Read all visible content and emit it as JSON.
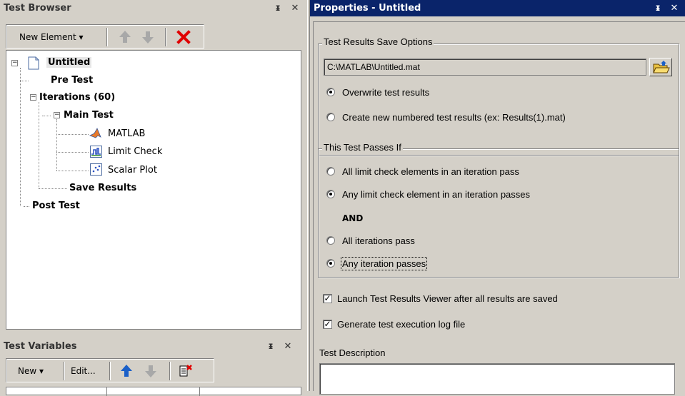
{
  "test_browser": {
    "title": "Test Browser",
    "pin_label": "ᵻ",
    "close_label": "✕",
    "toolbar": {
      "new_element_label": "New Element ▾"
    },
    "tree": {
      "root": "Untitled",
      "pre_test": "Pre Test",
      "iterations": "Iterations  (60)",
      "main_test": "Main Test",
      "matlab": "MATLAB",
      "limit_check": "Limit Check",
      "scalar_plot": "Scalar Plot",
      "save_results": "Save Results",
      "post_test": "Post Test"
    }
  },
  "test_variables": {
    "title": "Test Variables",
    "pin_label": "ᵻ",
    "close_label": "✕",
    "toolbar": {
      "new_label": "New ▾",
      "edit_label": "Edit..."
    }
  },
  "properties": {
    "title": "Properties - Untitled",
    "pin_label": "ᵻ",
    "close_label": "✕",
    "save_options": {
      "group_title": "Test Results Save Options",
      "file_path": "C:\\MATLAB\\Untitled.mat",
      "overwrite_label": "Overwrite test results",
      "create_new_label": "Create new numbered test results (ex: Results(1).mat)",
      "selected": "overwrite"
    },
    "pass_conditions": {
      "group_title": "This Test Passes If",
      "all_limit_label": "All limit check elements in an iteration pass",
      "any_limit_label": "Any limit check element in an iteration passes",
      "and_label": "AND",
      "all_iterations_label": "All iterations pass",
      "any_iteration_label": "Any iteration passes",
      "selected_element": "any_limit",
      "selected_iteration": "any_iteration"
    },
    "launch_viewer": {
      "label": "Launch Test Results Viewer after all results are saved",
      "checked": true
    },
    "generate_log": {
      "label": "Generate test execution log file",
      "checked": true
    },
    "description_label": "Test Description",
    "description_value": ""
  }
}
